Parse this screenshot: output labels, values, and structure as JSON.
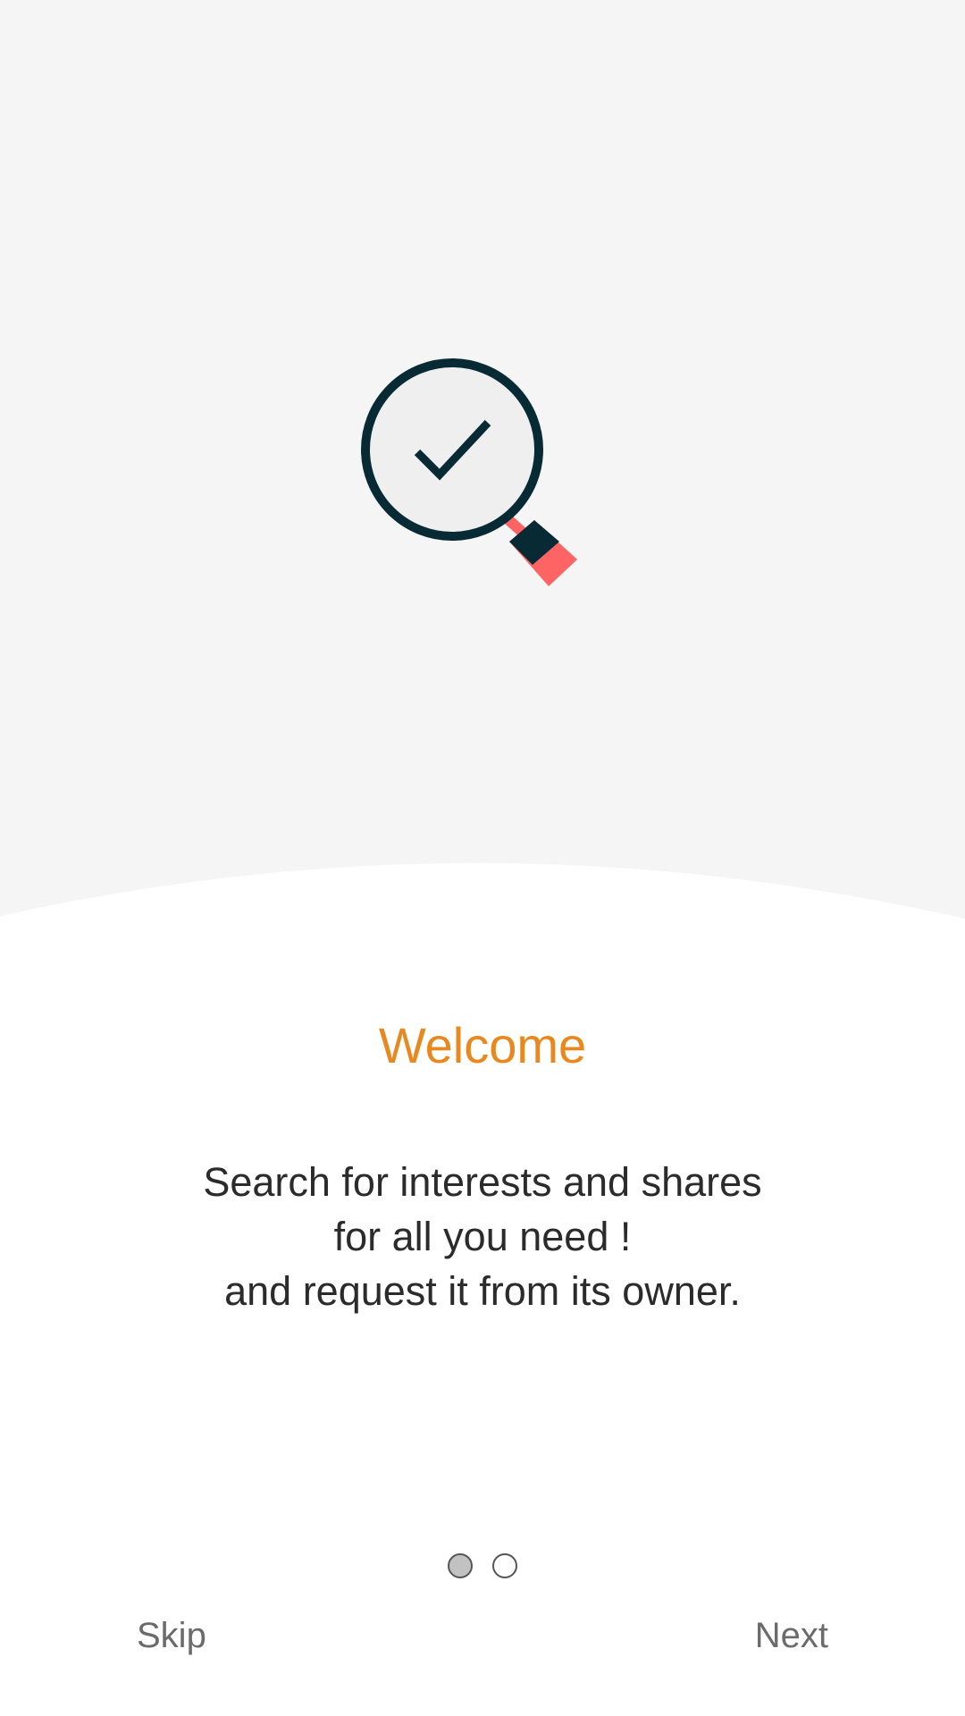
{
  "onboarding": {
    "title": "Welcome",
    "description_lines": [
      "Search for interests and shares",
      "for all you need !",
      "and request it from its owner."
    ],
    "illustration_icon": "magnifier-check-icon",
    "current_page": 1,
    "total_pages": 2
  },
  "nav": {
    "skip_label": "Skip",
    "next_label": "Next"
  },
  "colors": {
    "accent": "#E8881F",
    "hero_background": "#F5F5F5",
    "icon_dark": "#082A35",
    "icon_handle": "#FF6464",
    "text_dark": "#2B2B2B",
    "nav_text": "#6B6B6B"
  }
}
